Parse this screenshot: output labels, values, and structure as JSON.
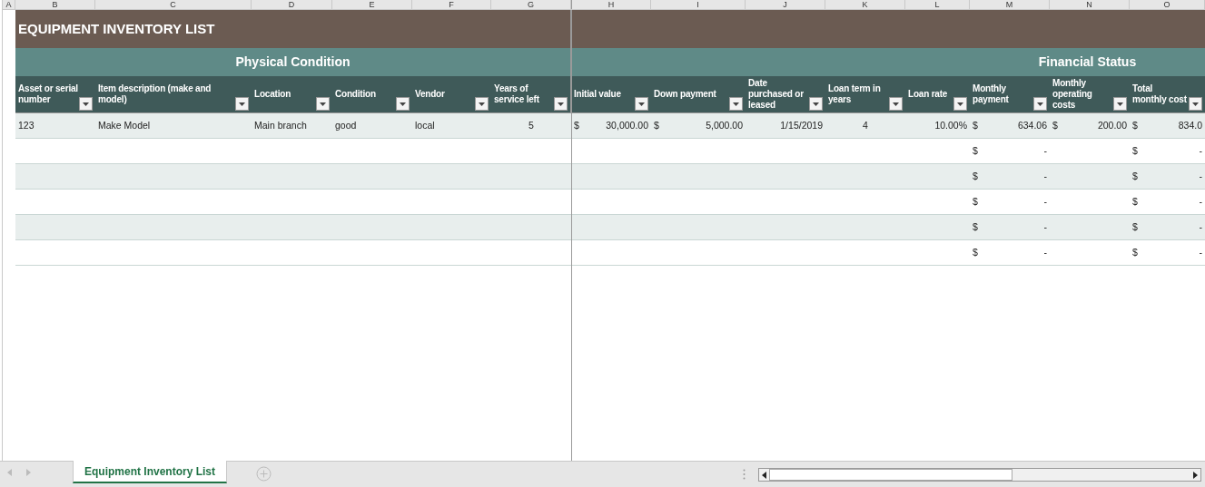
{
  "column_letters": [
    "A",
    "B",
    "C",
    "D",
    "E",
    "F",
    "G",
    "H",
    "I",
    "J",
    "K",
    "L",
    "M",
    "N",
    "O"
  ],
  "title": "EQUIPMENT INVENTORY LIST",
  "sections": [
    {
      "label": "Physical Condition"
    },
    {
      "label": "Financial Status"
    }
  ],
  "headers": [
    "Asset or serial number",
    "Item description (make and model)",
    "Location",
    "Condition",
    "Vendor",
    "Years of service left",
    "Initial value",
    "Down payment",
    "Date purchased or leased",
    "Loan term in years",
    "Loan rate",
    "Monthly payment",
    "Monthly operating costs",
    "Total monthly cost"
  ],
  "rows": [
    {
      "cells": [
        {
          "kind": "text",
          "text": "123"
        },
        {
          "kind": "text",
          "text": "Make Model"
        },
        {
          "kind": "text",
          "text": "Main branch"
        },
        {
          "kind": "text",
          "text": "good"
        },
        {
          "kind": "text",
          "text": "local"
        },
        {
          "kind": "centered",
          "text": "5"
        },
        {
          "kind": "currency",
          "symbol": "$",
          "text": "30,000.00"
        },
        {
          "kind": "currency",
          "symbol": "$",
          "text": "5,000.00"
        },
        {
          "kind": "right",
          "text": "1/15/2019"
        },
        {
          "kind": "centered",
          "text": "4"
        },
        {
          "kind": "right",
          "text": "10.00%"
        },
        {
          "kind": "currency",
          "symbol": "$",
          "text": "634.06"
        },
        {
          "kind": "currency",
          "symbol": "$",
          "text": "200.00"
        },
        {
          "kind": "currency",
          "symbol": "$",
          "text": "834.0"
        }
      ]
    },
    {
      "cells": [
        null,
        null,
        null,
        null,
        null,
        null,
        null,
        null,
        null,
        null,
        null,
        {
          "kind": "currency",
          "symbol": "$",
          "text": "-"
        },
        null,
        {
          "kind": "currency",
          "symbol": "$",
          "text": "-"
        }
      ]
    },
    {
      "cells": [
        null,
        null,
        null,
        null,
        null,
        null,
        null,
        null,
        null,
        null,
        null,
        {
          "kind": "currency",
          "symbol": "$",
          "text": "-"
        },
        null,
        {
          "kind": "currency",
          "symbol": "$",
          "text": "-"
        }
      ]
    },
    {
      "cells": [
        null,
        null,
        null,
        null,
        null,
        null,
        null,
        null,
        null,
        null,
        null,
        {
          "kind": "currency",
          "symbol": "$",
          "text": "-"
        },
        null,
        {
          "kind": "currency",
          "symbol": "$",
          "text": "-"
        }
      ]
    },
    {
      "cells": [
        null,
        null,
        null,
        null,
        null,
        null,
        null,
        null,
        null,
        null,
        null,
        {
          "kind": "currency",
          "symbol": "$",
          "text": "-"
        },
        null,
        {
          "kind": "currency",
          "symbol": "$",
          "text": "-"
        }
      ]
    },
    {
      "cells": [
        null,
        null,
        null,
        null,
        null,
        null,
        null,
        null,
        null,
        null,
        null,
        {
          "kind": "currency",
          "symbol": "$",
          "text": "-"
        },
        null,
        {
          "kind": "currency",
          "symbol": "$",
          "text": "-"
        }
      ]
    }
  ],
  "tabs": [
    {
      "label": "Equipment Inventory List",
      "selected": true
    }
  ]
}
